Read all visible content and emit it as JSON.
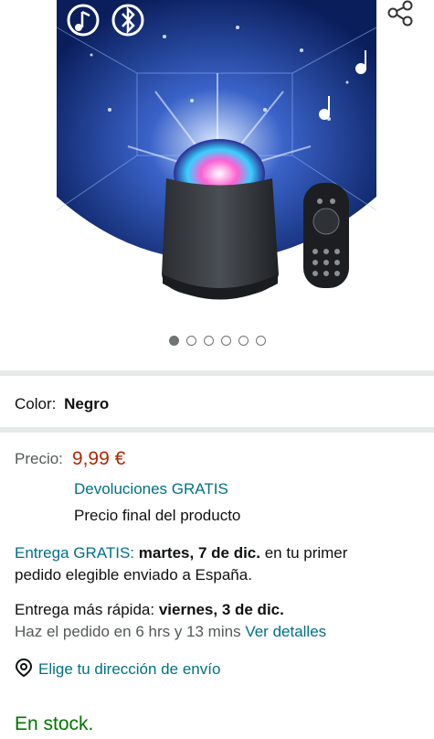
{
  "carousel": {
    "total": 6,
    "active": 0
  },
  "color": {
    "label": "Color:",
    "value": "Negro"
  },
  "price": {
    "label": "Precio:",
    "value": "9,99 €"
  },
  "returns": "Devoluciones GRATIS",
  "final_price": "Precio final del producto",
  "delivery": {
    "prefix": "Entrega GRATIS:",
    "date": "martes, 7 de dic.",
    "suffix": "en tu primer",
    "line2": "pedido elegible enviado a España."
  },
  "fast_delivery": {
    "prefix": "Entrega más rápida:",
    "date": "viernes, 3 de dic.",
    "order_text": "Haz el pedido en 6 hrs y 13 mins",
    "details_link": "Ver detalles"
  },
  "address_link": "Elige tu dirección de envío",
  "stock": "En stock.",
  "colors": {
    "price": "#b12704",
    "link": "#007185",
    "stock": "#007600"
  }
}
